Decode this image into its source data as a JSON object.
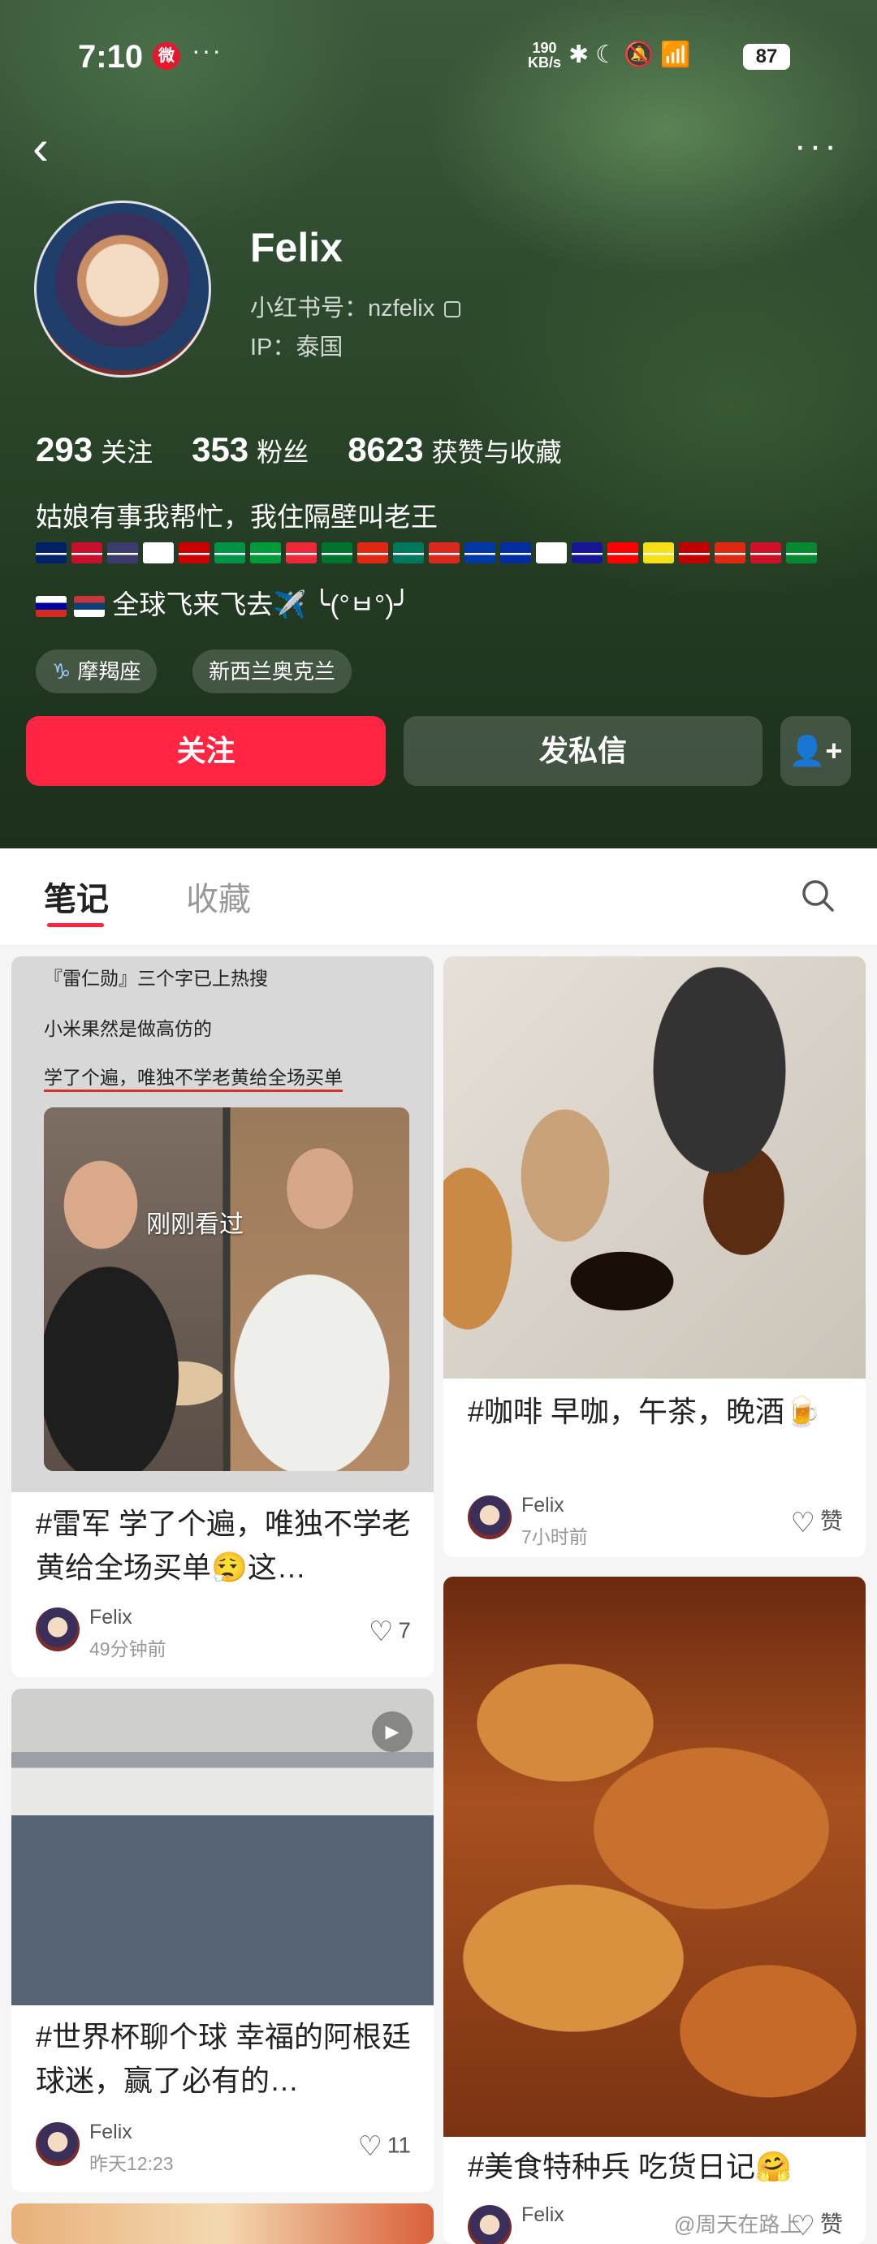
{
  "status": {
    "time": "7:10",
    "speed_top": "190",
    "speed_unit": "KB/s",
    "battery": "87"
  },
  "profile": {
    "name": "Felix",
    "id_label": "小红书号：nzfelix",
    "ip_label": "IP：泰国",
    "following_count": "293",
    "following_label": "关注",
    "followers_count": "353",
    "followers_label": "粉丝",
    "likes_count": "8623",
    "likes_label": "获赞与收藏",
    "bio_line1": "姑娘有事我帮忙，我住隔壁叫老王",
    "bio_line2": "全球飞来飞去✈️ ╰(°ㅂ°)╯",
    "tags": [
      "摩羯座",
      "新西兰奥克兰"
    ]
  },
  "buttons": {
    "follow": "关注",
    "message": "发私信"
  },
  "tabs": {
    "notes": "笔记",
    "favorites": "收藏"
  },
  "flag_colors": [
    "#012169",
    "#c8102e",
    "#3c3b6e",
    "#ffffff",
    "#cc0001",
    "#009246",
    "#009c3b",
    "#ed2939",
    "#00732f",
    "#de2910",
    "#00785e",
    "#da291c",
    "#0038a8",
    "#032ea1",
    "#ffffff",
    "#171796",
    "#ff0000",
    "#f7e017",
    "#c10000",
    "#de2910",
    "#ce1126",
    "#078930"
  ],
  "feed": [
    {
      "cover_lines": [
        "『雷仁勋』三个字已上热搜",
        "小米果然是做高仿的",
        "学了个遍，唯独不学老黄给全场买单"
      ],
      "cover_overlay": "刚刚看过",
      "title": "#雷军 学了个遍，唯独不学老黄给全场买单😮‍💨这…",
      "author": "Felix",
      "time": "49分钟前",
      "likes": "7"
    },
    {
      "title": "#咖啡 早咖，午茶，晚酒🍺",
      "author": "Felix",
      "time": "7小时前",
      "likes": "赞"
    },
    {
      "title": "#世界杯聊个球 幸福的阿根廷球迷，赢了必有的…",
      "author": "Felix",
      "time": "昨天12:23",
      "likes": "11"
    },
    {
      "title": "#美食特种兵 吃货日记🤗",
      "author": "Felix",
      "likes": "赞"
    }
  ],
  "watermark": "@周天在路上"
}
